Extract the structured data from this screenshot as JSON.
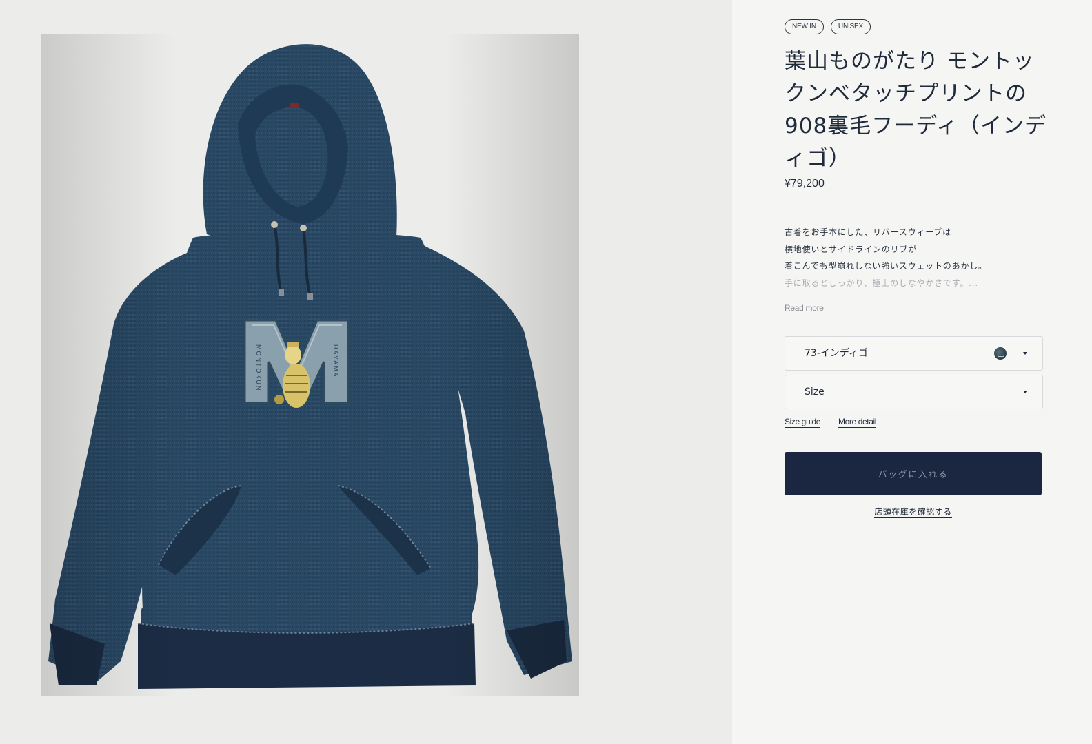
{
  "product": {
    "badges": [
      "NEW IN",
      "UNISEX"
    ],
    "title": "葉山ものがたり モントックンベタッチプリントの908裏毛フーディ（インディゴ）",
    "price": "¥79,200",
    "description": [
      "古着をお手本にした、リバースウィーブは",
      "横地使いとサイドラインのリブが",
      "着こんでも型崩れしない強いスウェットのあかし。",
      "手に取るとしっかり、極上のしなやかさです。..."
    ],
    "read_more": "Read more"
  },
  "image": {
    "graphic_left_text": "MONTOKUN",
    "graphic_right_text": "HAYAMA"
  },
  "options": {
    "color": {
      "value": "73-インディゴ",
      "swatch": "indigo-swatch-icon"
    },
    "size": {
      "value": "Size"
    }
  },
  "links": {
    "size_guide": "Size guide",
    "more_detail": "More detail"
  },
  "actions": {
    "add_to_bag": "バッグに入れる",
    "store_stock": "店頭在庫を確認する"
  },
  "colors": {
    "primary": "#1b2640",
    "text": "#1f2a3a",
    "indigo": "#27455f"
  }
}
